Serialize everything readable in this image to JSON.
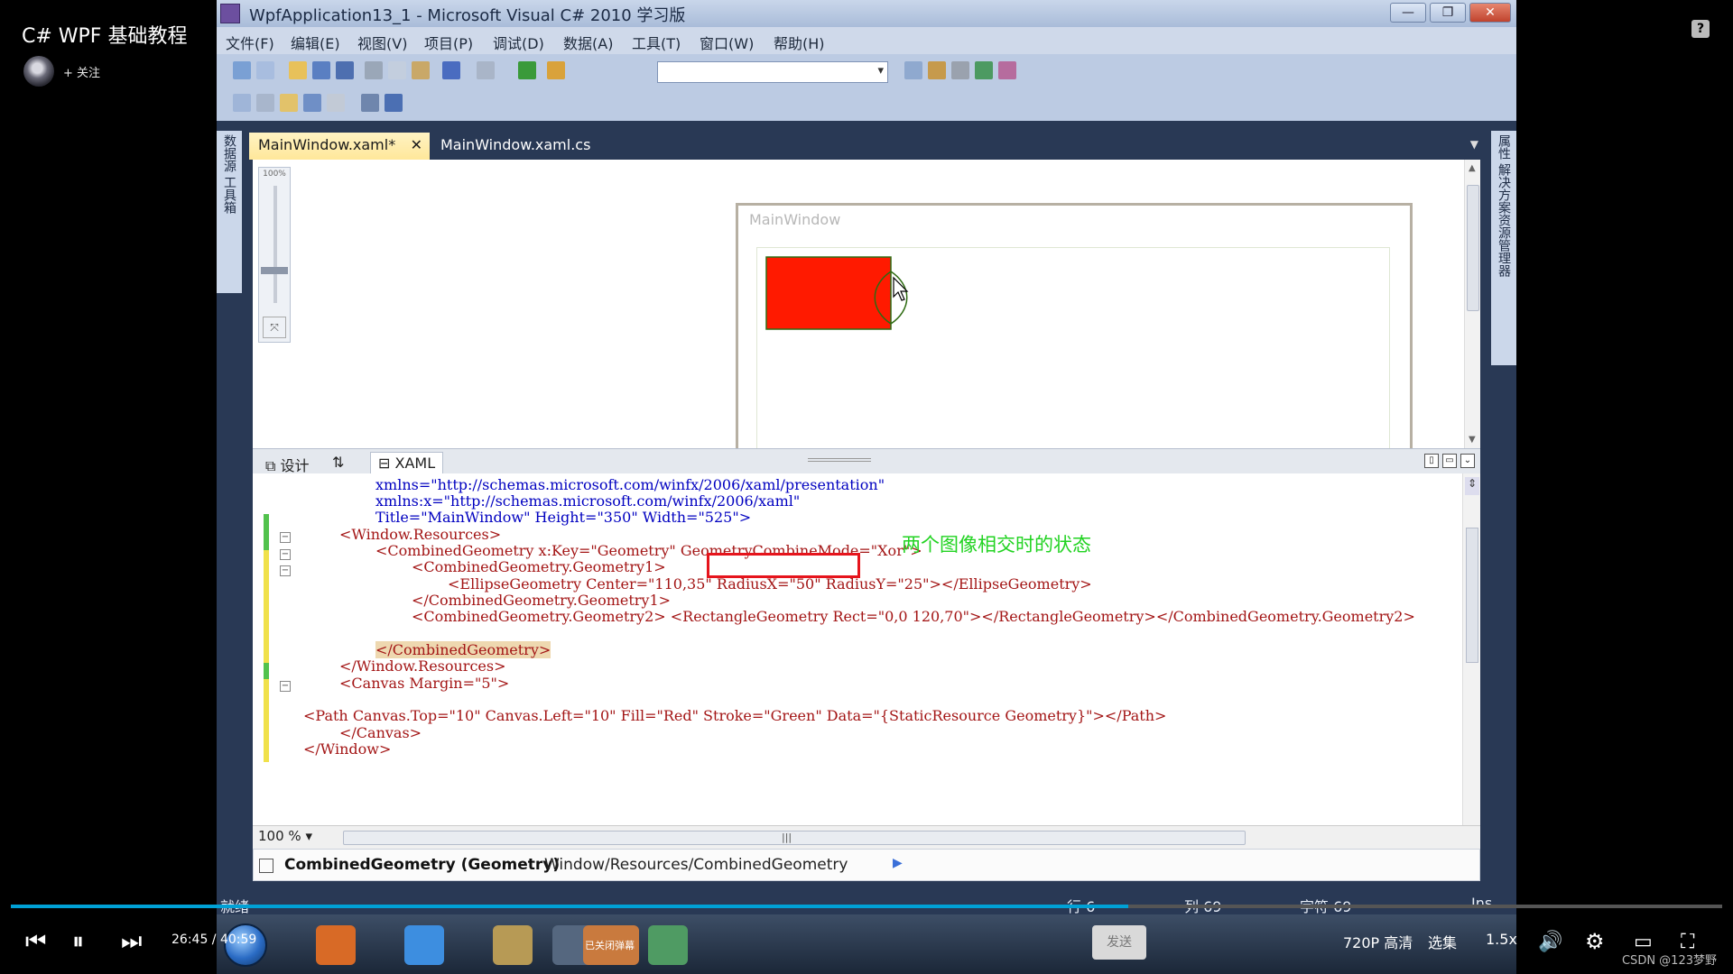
{
  "player": {
    "course_title": "C# WPF 基础教程",
    "follow_label": "+ 关注",
    "help_icon": "?",
    "time_current": "26:45",
    "time_total": "40:59",
    "send_label": "发送",
    "quality_label": "720P 高清",
    "episodes_label": "选集",
    "speed_label": "1.5x",
    "watermark": "CSDN @123梦野",
    "progress_fraction": 0.653
  },
  "window": {
    "title": "WpfApplication13_1 - Microsoft Visual C# 2010 学习版",
    "minimize": "—",
    "restore": "❐",
    "close": "✕"
  },
  "menu": [
    "文件(F)",
    "编辑(E)",
    "视图(V)",
    "项目(P)",
    "调试(D)",
    "数据(A)",
    "工具(T)",
    "窗口(W)",
    "帮助(H)"
  ],
  "side_left": [
    "数据源",
    "工具箱"
  ],
  "side_right": [
    "属性",
    "解决方案资源管理器"
  ],
  "tabs": {
    "active": "MainWindow.xaml*",
    "inactive": "MainWindow.xaml.cs",
    "close": "✕"
  },
  "designer": {
    "zoom_label": "100%",
    "window_title": "MainWindow",
    "fill_color": "#ff1a00",
    "stroke_color": "#2e6b12"
  },
  "split": {
    "design_tab": "设计",
    "swap_icon": "⇅",
    "xaml_tab": "XAML"
  },
  "code": {
    "lines": [
      "xmlns=\"http://schemas.microsoft.com/winfx/2006/xaml/presentation\"",
      "xmlns:x=\"http://schemas.microsoft.com/winfx/2006/xaml\"",
      "Title=\"MainWindow\" Height=\"350\" Width=\"525\">",
      "<Window.Resources>",
      "<CombinedGeometry x:Key=\"Geometry\" GeometryCombineMode=\"Xor\">",
      "<CombinedGeometry.Geometry1>",
      "<EllipseGeometry Center=\"110,35\" RadiusX=\"50\" RadiusY=\"25\"></EllipseGeometry>",
      "</CombinedGeometry.Geometry1>",
      "<CombinedGeometry.Geometry2> <RectangleGeometry Rect=\"0,0 120,70\"></RectangleGeometry></CombinedGeometry.Geometry2>",
      "",
      "</CombinedGeometry>",
      "</Window.Resources>",
      "<Canvas Margin=\"5\">",
      "",
      "<Path Canvas.Top=\"10\" Canvas.Left=\"10\" Fill=\"Red\" Stroke=\"Green\" Data=\"{StaticResource Geometry}\"></Path>",
      "</Canvas>",
      "</Window>"
    ],
    "annotation": "两个图像相交时的状态"
  },
  "editor_footer": {
    "zoom": "100 %",
    "hscroll_grip": "|||"
  },
  "breadcrumb": {
    "element": "CombinedGeometry (Geometry)",
    "path": "Window/Resources/CombinedGeometry",
    "arrow": "▶"
  },
  "status": {
    "ready": "就绪",
    "row": "行 6",
    "col": "列 69",
    "char": "字符 69",
    "mode": "Ins"
  },
  "taskbar": {
    "active_app_label": "已关闭弹幕"
  }
}
